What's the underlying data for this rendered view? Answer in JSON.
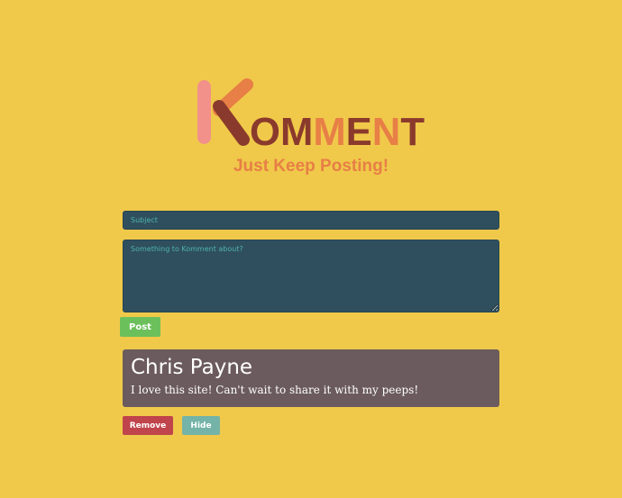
{
  "brand": {
    "logo_text": "KOMMENT",
    "tagline": "Just Keep Posting!"
  },
  "form": {
    "subject_placeholder": "Subject",
    "comment_placeholder": "Something to Komment about?",
    "post_label": "Post"
  },
  "comment": {
    "author": "Chris Payne",
    "body": "I love this site! Can't wait to share it with my peeps!",
    "remove_label": "Remove",
    "hide_label": "Hide"
  },
  "colors": {
    "background": "#F0C94A",
    "input_background": "#2F4F5E",
    "placeholder": "#4FB3AC",
    "post_button": "#6CC05B",
    "comment_card": "#6B5B5E",
    "remove_button": "#C0444C",
    "hide_button": "#73B3A8"
  }
}
